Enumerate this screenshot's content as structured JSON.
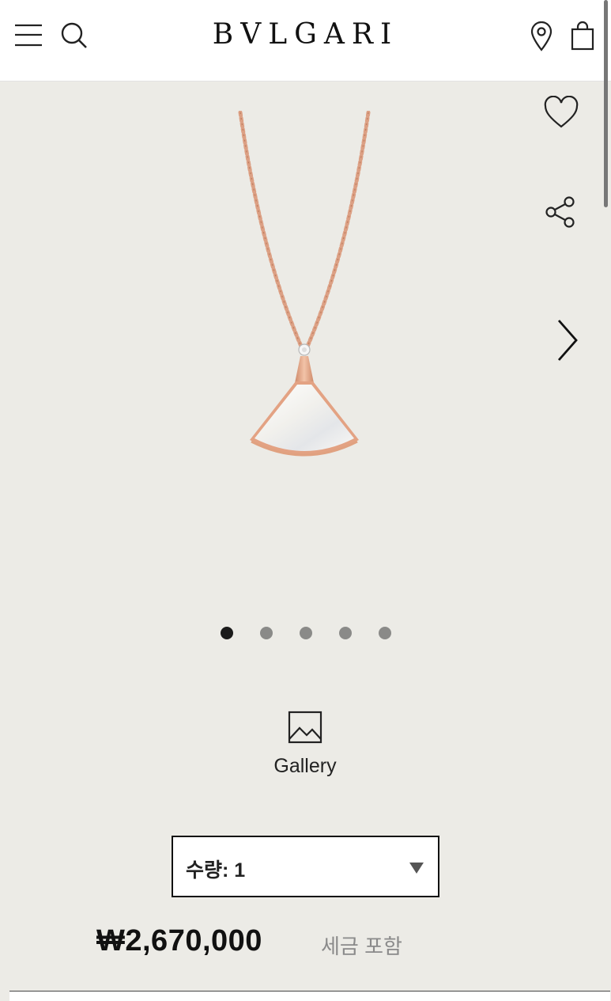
{
  "header": {
    "brand": "BVLGARI",
    "menu_icon": "hamburger-menu-icon",
    "search_icon": "search-icon",
    "store_icon": "location-pin-icon",
    "bag_icon": "shopping-bag-icon"
  },
  "product_actions": {
    "wishlist_icon": "heart-icon",
    "share_icon": "share-icon",
    "next_icon": "chevron-right-icon"
  },
  "carousel": {
    "image_count": 5,
    "active_index": 0
  },
  "gallery": {
    "icon": "image-icon",
    "label": "Gallery"
  },
  "quantity": {
    "label": "수량: 1",
    "value": 1
  },
  "price": {
    "amount": "₩2,670,000",
    "tax_note": "세금 포함"
  },
  "colors": {
    "page_background": "#ecebe6",
    "header_background": "#ffffff",
    "active_dot": "#1b1b1b",
    "inactive_dot": "#8a8a88",
    "rose_gold": "#e2a88a"
  }
}
